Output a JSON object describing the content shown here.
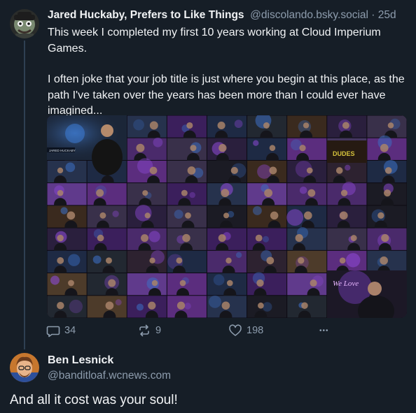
{
  "parent_post": {
    "author_name": "Jared Huckaby, Prefers to Like Things",
    "author_handle": "@discolando.bsky.social",
    "time_sep": " · ",
    "time_ago": "25d",
    "paragraphs": [
      "This week I completed my first 10 years working at Cloud Imperium Games.",
      "I often joke that your job title is just where you begin at this place, as the path I've taken over the years has been more than I could ever have imagined..."
    ],
    "media": {
      "type": "photo-collage",
      "visible_texts": [
        "JARED HUCKABY",
        "DUDES",
        "We Love"
      ]
    },
    "actions": {
      "reply_count": "34",
      "repost_count": "9",
      "like_count": "198",
      "more_label": "•••"
    }
  },
  "reply": {
    "author_name": "Ben Lesnick",
    "author_handle": "@banditloaf.wcnews.com",
    "text": "And all it cost was your soul!"
  },
  "colors": {
    "background": "#161e27",
    "text": "#f1f3f5",
    "muted": "#8d9cad",
    "thread_line": "#2e4052"
  },
  "icons": [
    "reply-icon",
    "repost-icon",
    "like-icon",
    "more-icon"
  ]
}
